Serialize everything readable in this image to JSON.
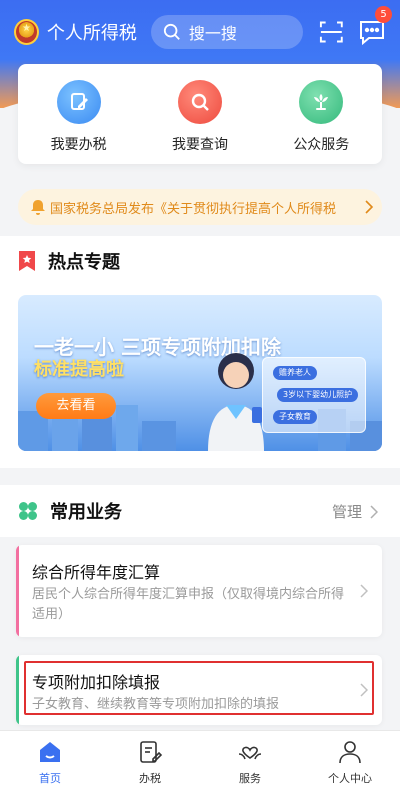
{
  "header": {
    "app_title": "个人所得税",
    "search_placeholder": "搜一搜",
    "message_count": "5"
  },
  "quick_actions": [
    {
      "label": "我要办税",
      "icon": "pen-icon",
      "color": "#4a9cf7"
    },
    {
      "label": "我要查询",
      "icon": "search-icon",
      "color": "#f2564a"
    },
    {
      "label": "公众服务",
      "icon": "flower-icon",
      "color": "#3fc48a"
    }
  ],
  "notice": {
    "text": "国家税务总局发布《关于贯彻执行提高个人所得税",
    "color": "#e08a1a"
  },
  "hot_topics": {
    "title": "热点专题",
    "banner": {
      "title": "一老一小 三项专项附加扣除",
      "subtitle": "标准提高啦",
      "button": "去看看",
      "tags": [
        "赡养老人",
        "3岁以下婴幼儿照护",
        "子女教育"
      ]
    }
  },
  "common_services": {
    "title": "常用业务",
    "manage_label": "管理",
    "items": [
      {
        "title": "综合所得年度汇算",
        "desc": "居民个人综合所得年度汇算申报（仅取得境内综合所得适用）",
        "accent": "#f26fa0"
      },
      {
        "title": "专项附加扣除填报",
        "desc": "子女教育、继续教育等专项附加扣除的填报",
        "accent": "#3fc48a"
      }
    ]
  },
  "tabbar": {
    "items": [
      {
        "label": "首页",
        "active": true
      },
      {
        "label": "办税",
        "active": false
      },
      {
        "label": "服务",
        "active": false
      },
      {
        "label": "个人中心",
        "active": false
      }
    ]
  },
  "colors": {
    "brand_blue": "#3c6df2",
    "active_tab": "#3a70f0",
    "highlight_border": "#e03030"
  }
}
